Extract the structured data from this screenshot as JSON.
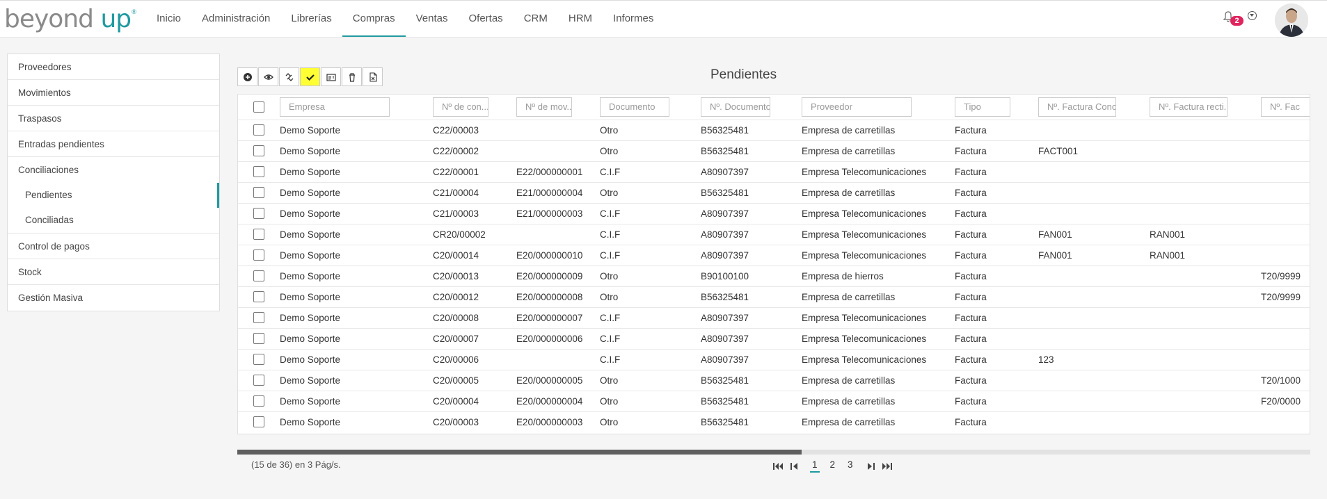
{
  "brand": {
    "part1": "beyond ",
    "part2": "up",
    "reg": "®"
  },
  "nav": [
    "Inicio",
    "Administración",
    "Librerías",
    "Compras",
    "Ventas",
    "Ofertas",
    "CRM",
    "HRM",
    "Informes"
  ],
  "notifications": {
    "count": "2"
  },
  "sidebar": {
    "items_top": [
      "Proveedores",
      "Movimientos",
      "Traspasos",
      "Entradas pendientes",
      "Conciliaciones"
    ],
    "sub": [
      "Pendientes",
      "Conciliadas"
    ],
    "items_bottom": [
      "Control de pagos",
      "Stock",
      "Gestión Masiva"
    ]
  },
  "main": {
    "title": "Pendientes"
  },
  "table": {
    "headers": [
      "Empresa",
      "Nº de con...",
      "Nº de mov...",
      "Documento",
      "Nº. Documento",
      "Proveedor",
      "Tipo",
      "Nº. Factura Conc...",
      "Nº. Factura recti...",
      "Nº. Fac"
    ],
    "rows": [
      [
        "Demo Soporte",
        "C22/00003",
        "",
        "Otro",
        "B56325481",
        "Empresa de carretillas",
        "Factura",
        "",
        "",
        ""
      ],
      [
        "Demo Soporte",
        "C22/00002",
        "",
        "Otro",
        "B56325481",
        "Empresa de carretillas",
        "Factura",
        "FACT001",
        "",
        ""
      ],
      [
        "Demo Soporte",
        "C22/00001",
        "E22/000000001",
        "C.I.F",
        "A80907397",
        "Empresa Telecomunicaciones",
        "Factura",
        "",
        "",
        ""
      ],
      [
        "Demo Soporte",
        "C21/00004",
        "E21/000000004",
        "Otro",
        "B56325481",
        "Empresa de carretillas",
        "Factura",
        "",
        "",
        ""
      ],
      [
        "Demo Soporte",
        "C21/00003",
        "E21/000000003",
        "C.I.F",
        "A80907397",
        "Empresa Telecomunicaciones",
        "Factura",
        "",
        "",
        ""
      ],
      [
        "Demo Soporte",
        "CR20/00002",
        "",
        "C.I.F",
        "A80907397",
        "Empresa Telecomunicaciones",
        "Factura",
        "FAN001",
        "RAN001",
        ""
      ],
      [
        "Demo Soporte",
        "C20/00014",
        "E20/000000010",
        "C.I.F",
        "A80907397",
        "Empresa Telecomunicaciones",
        "Factura",
        "FAN001",
        "RAN001",
        ""
      ],
      [
        "Demo Soporte",
        "C20/00013",
        "E20/000000009",
        "Otro",
        "B90100100",
        "Empresa de hierros",
        "Factura",
        "",
        "",
        "T20/9999"
      ],
      [
        "Demo Soporte",
        "C20/00012",
        "E20/000000008",
        "Otro",
        "B56325481",
        "Empresa de carretillas",
        "Factura",
        "",
        "",
        "T20/9999"
      ],
      [
        "Demo Soporte",
        "C20/00008",
        "E20/000000007",
        "C.I.F",
        "A80907397",
        "Empresa Telecomunicaciones",
        "Factura",
        "",
        "",
        ""
      ],
      [
        "Demo Soporte",
        "C20/00007",
        "E20/000000006",
        "C.I.F",
        "A80907397",
        "Empresa Telecomunicaciones",
        "Factura",
        "",
        "",
        ""
      ],
      [
        "Demo Soporte",
        "C20/00006",
        "",
        "C.I.F",
        "A80907397",
        "Empresa Telecomunicaciones",
        "Factura",
        "123",
        "",
        ""
      ],
      [
        "Demo Soporte",
        "C20/00005",
        "E20/000000005",
        "Otro",
        "B56325481",
        "Empresa de carretillas",
        "Factura",
        "",
        "",
        "T20/1000"
      ],
      [
        "Demo Soporte",
        "C20/00004",
        "E20/000000004",
        "Otro",
        "B56325481",
        "Empresa de carretillas",
        "Factura",
        "",
        "",
        "F20/0000"
      ],
      [
        "Demo Soporte",
        "C20/00003",
        "E20/000000003",
        "Otro",
        "B56325481",
        "Empresa de carretillas",
        "Factura",
        "",
        "",
        ""
      ]
    ]
  },
  "footer": {
    "count": "(15 de 36) en 3 Pág/s.",
    "pages": [
      "1",
      "2",
      "3"
    ],
    "current_page": "1"
  },
  "toolbar": {
    "icons": [
      "add-icon",
      "view-icon",
      "link-icon",
      "check-icon",
      "card-icon",
      "trash-icon",
      "export-icon"
    ],
    "highlight": "#ffff33"
  },
  "colors": {
    "accent": "#1f9aa0",
    "badge": "#e0245e"
  }
}
